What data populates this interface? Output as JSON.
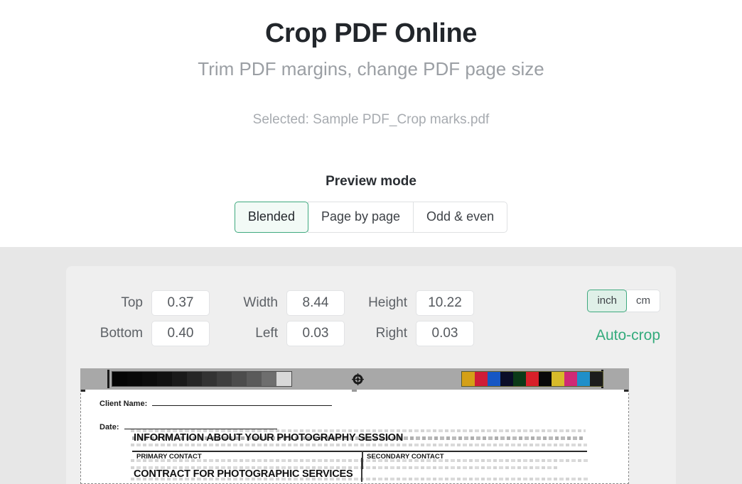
{
  "header": {
    "title": "Crop PDF Online",
    "subtitle": "Trim PDF margins, change PDF page size",
    "selected_file": "Selected: Sample PDF_Crop marks.pdf"
  },
  "preview_mode": {
    "label": "Preview mode",
    "options": [
      {
        "label": "Blended",
        "active": true
      },
      {
        "label": "Page by page",
        "active": false
      },
      {
        "label": "Odd & even",
        "active": false
      }
    ]
  },
  "crop_controls": {
    "fields": [
      {
        "label": "Top",
        "value": "0.37"
      },
      {
        "label": "Width",
        "value": "8.44"
      },
      {
        "label": "Height",
        "value": "10.22"
      },
      {
        "label": "Bottom",
        "value": "0.40"
      },
      {
        "label": "Left",
        "value": "0.03"
      },
      {
        "label": "Right",
        "value": "0.03"
      }
    ],
    "units": [
      {
        "label": "inch",
        "active": true
      },
      {
        "label": "cm",
        "active": false
      }
    ],
    "auto_crop_label": "Auto-crop"
  },
  "pdf_preview": {
    "client_name_label": "Client Name:",
    "date_label": "Date:",
    "blended_headings": [
      "INFORMATION ABOUT YOUR PHOTOGRAPHY SESSION",
      "CONTRACT FOR PHOTOGRAPHIC SERVICES"
    ],
    "primary_contact_label": "PRIMARY CONTACT",
    "secondary_contact_label": "SECONDARY CONTACT"
  },
  "colors": {
    "accent_green": "#34ab7c",
    "active_border": "#3fa97f",
    "active_fill": "#f2faf6",
    "unit_active_fill": "#dff0e8",
    "band_background": "#e7e7e7",
    "panel_background": "#efefef",
    "title_text": "#22262b",
    "muted_text": "#9b9fa4"
  }
}
